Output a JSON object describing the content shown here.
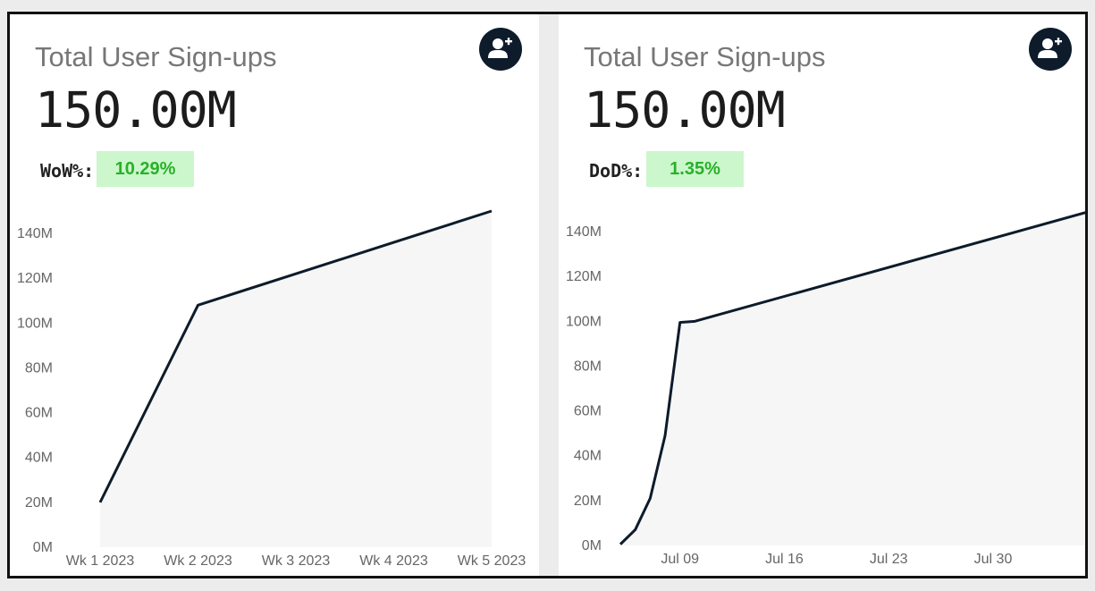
{
  "colors": {
    "line": "#0d1b2a",
    "area": "#f6f6f6",
    "badge_bg": "#ccf7cc",
    "badge_text": "#2ab02a",
    "title": "#777777"
  },
  "cards": [
    {
      "title": "Total User Sign-ups",
      "value": "150.00M",
      "delta_label": "WoW%:",
      "delta_value": "10.29%",
      "icon": "user-plus-icon"
    },
    {
      "title": "Total User Sign-ups",
      "value": "150.00M",
      "delta_label": "DoD%:",
      "delta_value": "1.35%",
      "icon": "user-plus-icon"
    }
  ],
  "chart_data": [
    {
      "type": "area",
      "title": "",
      "xlabel": "",
      "ylabel": "",
      "y_ticks": [
        "0M",
        "20M",
        "40M",
        "60M",
        "80M",
        "100M",
        "120M",
        "140M"
      ],
      "ylim": [
        0,
        150000000
      ],
      "grid": false,
      "categories": [
        "Wk 1 2023",
        "Wk 2 2023",
        "Wk 3 2023",
        "Wk 4 2023",
        "Wk 5 2023"
      ],
      "series": [
        {
          "values": [
            20000000,
            108000000,
            122000000,
            136000000,
            150000000
          ]
        }
      ]
    },
    {
      "type": "area",
      "title": "",
      "xlabel": "",
      "ylabel": "",
      "y_ticks": [
        "0M",
        "20M",
        "40M",
        "60M",
        "80M",
        "100M",
        "120M",
        "140M"
      ],
      "ylim": [
        0,
        150000000
      ],
      "grid": false,
      "x_ticks": [
        {
          "label": "Jul 09",
          "x": "2023-07-09"
        },
        {
          "label": "Jul 16",
          "x": "2023-07-16"
        },
        {
          "label": "Jul 23",
          "x": "2023-07-23"
        },
        {
          "label": "Jul 30",
          "x": "2023-07-30"
        }
      ],
      "series": [
        {
          "points": [
            {
              "x": "2023-07-05",
              "y": 500000
            },
            {
              "x": "2023-07-06",
              "y": 7000000
            },
            {
              "x": "2023-07-07",
              "y": 21000000
            },
            {
              "x": "2023-07-08",
              "y": 49000000
            },
            {
              "x": "2023-07-09",
              "y": 99500000
            },
            {
              "x": "2023-07-10",
              "y": 100000000
            },
            {
              "x": "2023-08-06",
              "y": 150000000
            }
          ]
        }
      ]
    }
  ]
}
